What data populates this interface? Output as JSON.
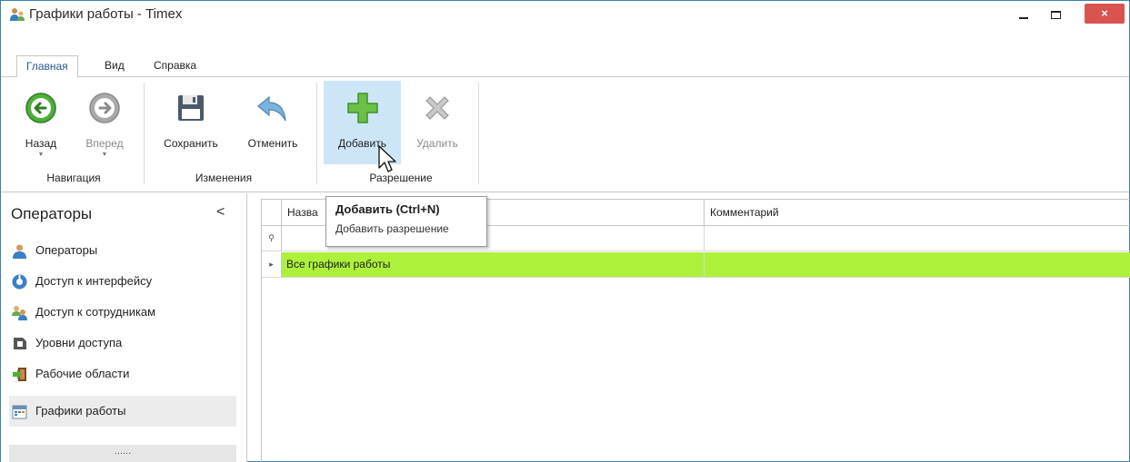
{
  "window": {
    "title": "Графики работы - Timex",
    "close_glyph": "×"
  },
  "tabs": [
    {
      "label": "Главная",
      "active": true
    },
    {
      "label": "Вид",
      "active": false
    },
    {
      "label": "Справка",
      "active": false
    }
  ],
  "ribbon": {
    "back_label": "Назад",
    "forward_label": "Вперед",
    "save_label": "Сохранить",
    "undo_label": "Отменить",
    "add_label": "Добавить",
    "delete_label": "Удалить",
    "groups": {
      "navigation": "Навигация",
      "changes": "Изменения",
      "permission": "Разрешение"
    }
  },
  "sidebar": {
    "title": "Операторы",
    "collapse_glyph": "<",
    "items": [
      {
        "label": "Операторы",
        "icon": "user-icon"
      },
      {
        "label": "Доступ к интерфейсу",
        "icon": "interface-access-icon"
      },
      {
        "label": "Доступ к сотрудникам",
        "icon": "employees-access-icon"
      },
      {
        "label": "Уровни доступа",
        "icon": "access-level-icon"
      },
      {
        "label": "Рабочие области",
        "icon": "workspace-icon"
      },
      {
        "label": "Графики работы",
        "icon": "calendar-icon",
        "selected": true
      }
    ],
    "footer": "......"
  },
  "grid": {
    "columns": [
      "Назва",
      "Комментарий"
    ],
    "new_row_glyph": "⚲",
    "rows": [
      {
        "name": "Все графики работы",
        "comment": "",
        "highlight": true,
        "indicator": "▸"
      }
    ]
  },
  "tooltip": {
    "title": "Добавить (Ctrl+N)",
    "description": "Добавить разрешение"
  },
  "colors": {
    "highlight_row": "#adf13a",
    "hover_button": "#cde6f7",
    "close_button": "#d9534f",
    "add_icon": "#6cc04a"
  }
}
